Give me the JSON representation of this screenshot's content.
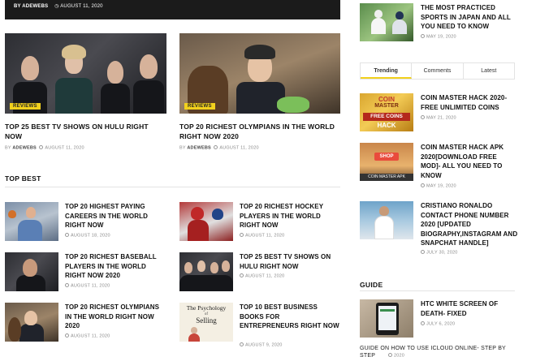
{
  "hero": {
    "author": "BY ADEWEBS",
    "date": "AUGUST 11, 2020"
  },
  "featured": [
    {
      "badge": "REVIEWS",
      "title": "TOP 25 BEST TV SHOWS ON HULU RIGHT NOW",
      "author": "ADEWEBS",
      "date": "AUGUST 11, 2020"
    },
    {
      "badge": "REVIEWS",
      "title": "TOP 20 RICHEST OLYMPIANS IN THE WORLD RIGHT NOW 2020",
      "author": "ADEWEBS",
      "date": "AUGUST 11, 2020"
    }
  ],
  "top_best": {
    "heading": "TOP BEST",
    "left": [
      {
        "title": "TOP 20 HIGHEST PAYING CAREERS IN THE WORLD RIGHT NOW",
        "date": "AUGUST 18, 2020"
      },
      {
        "title": "TOP 20 RICHEST BASEBALL PLAYERS IN THE WORLD RIGHT NOW 2020",
        "date": "AUGUST 11, 2020"
      },
      {
        "title": "TOP 20 RICHEST OLYMPIANS IN THE WORLD RIGHT NOW 2020",
        "date": "AUGUST 11, 2020"
      }
    ],
    "right": [
      {
        "title": "TOP 20 RICHEST HOCKEY PLAYERS IN THE WORLD RIGHT NOW",
        "date": "AUGUST 11, 2020"
      },
      {
        "title": "TOP 25 BEST TV SHOWS ON HULU RIGHT NOW",
        "date": "AUGUST 11, 2020"
      },
      {
        "title": "TOP 10 BEST BUSINESS BOOKS FOR ENTREPRENEURS RIGHT NOW",
        "date": "AUGUST 9, 2020",
        "book_line1": "The Psychology",
        "book_line2": "Selling",
        "book_of": "of"
      }
    ]
  },
  "sidebar": {
    "top_post": {
      "title": "THE MOST PRACTICED SPORTS IN JAPAN AND ALL YOU NEED TO KNOW",
      "date": "MAY 19, 2020"
    },
    "tabs": [
      "Trending",
      "Comments",
      "Latest"
    ],
    "trending": [
      {
        "title": "COIN MASTER HACK 2020- FREE UNLIMITED COINS",
        "date": "MAY 21, 2020",
        "img_text1": "COIN",
        "img_text2": "MASTER",
        "img_text3": "FREE COINS",
        "img_text4": "HACK"
      },
      {
        "title": "COIN MASTER HACK APK 2020[DOWNLOAD FREE MOD]- ALL YOU NEED TO KNOW",
        "date": "MAY 19, 2020",
        "img_text1": "SHOP",
        "img_text2": "COIN MASTER APK"
      },
      {
        "title": "CRISTIANO RONALDO CONTACT PHONE NUMBER 2020 [UPDATED BIOGRAPHY,INSTAGRAM AND SNAPCHAT HANDLE]",
        "date": "JULY 30, 2020"
      }
    ],
    "guide": {
      "heading": "GUIDE",
      "item": {
        "title": "HTC WHITE SCREEN OF DEATH- FIXED",
        "date": "JULY 6, 2020"
      },
      "next_title": "GUIDE ON HOW TO USE ICLOUD ONLINE- STEP BY STEP",
      "next_date": "2020"
    }
  },
  "colors": {
    "accent": "#f2d11d",
    "meta": "#8a8a8a",
    "text": "#111111"
  }
}
